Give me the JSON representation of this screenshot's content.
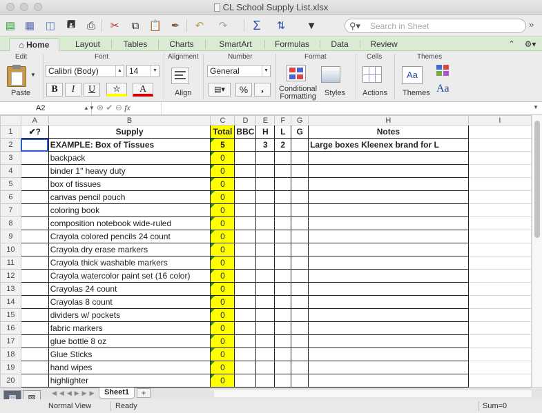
{
  "window": {
    "title": "CL School Supply List.xlsx"
  },
  "search": {
    "placeholder": "Search in Sheet"
  },
  "tabs": [
    "Home",
    "Layout",
    "Tables",
    "Charts",
    "SmartArt",
    "Formulas",
    "Data",
    "Review"
  ],
  "active_tab": "Home",
  "ribbon": {
    "groups": {
      "edit": "Edit",
      "font": "Font",
      "alignment": "Alignment",
      "number": "Number",
      "format": "Format",
      "cells": "Cells",
      "themes": "Themes"
    },
    "paste_label": "Paste",
    "font_name": "Calibri (Body)",
    "font_size": "14",
    "bold": "B",
    "italic": "I",
    "underline": "U",
    "align_label": "Align",
    "number_format": "General",
    "percent": "%",
    "comma": ",",
    "conditional_formatting_1": "Conditional",
    "conditional_formatting_2": "Formatting",
    "styles_label": "Styles",
    "actions_label": "Actions",
    "themes_label": "Themes",
    "themes_font": "Aa",
    "themes_sample": "Aa"
  },
  "formula_bar": {
    "cell_ref": "A2",
    "fx": "fx",
    "content": ""
  },
  "columns": [
    "A",
    "B",
    "C",
    "D",
    "E",
    "F",
    "G",
    "H",
    "I"
  ],
  "header_row": {
    "a": "✔?",
    "b": "Supply",
    "c": "Total",
    "d": "BBC",
    "e": "H",
    "f": "L",
    "g": "G",
    "h": "Notes"
  },
  "rows": [
    {
      "n": "2",
      "a": "",
      "b": "EXAMPLE:  Box of Tissues",
      "c": "5",
      "d": "",
      "e": "3",
      "f": "2",
      "g": "",
      "h": "Large boxes Kleenex brand for L"
    },
    {
      "n": "3",
      "b": "backpack",
      "c": "0"
    },
    {
      "n": "4",
      "b": "binder 1\" heavy duty",
      "c": "0"
    },
    {
      "n": "5",
      "b": "box of tissues",
      "c": "0"
    },
    {
      "n": "6",
      "b": "canvas pencil pouch",
      "c": "0"
    },
    {
      "n": "7",
      "b": "coloring book",
      "c": "0"
    },
    {
      "n": "8",
      "b": "composition notebook wide-ruled",
      "c": "0"
    },
    {
      "n": "9",
      "b": "Crayola colored pencils 24 count",
      "c": "0"
    },
    {
      "n": "10",
      "b": "Crayola dry erase markers",
      "c": "0"
    },
    {
      "n": "11",
      "b": "Crayola thick washable markers",
      "c": "0"
    },
    {
      "n": "12",
      "b": "Crayola watercolor paint set (16 color)",
      "c": "0"
    },
    {
      "n": "13",
      "b": "Crayolas 24 count",
      "c": "0"
    },
    {
      "n": "14",
      "b": "Crayolas 8 count",
      "c": "0"
    },
    {
      "n": "15",
      "b": "dividers w/ pockets",
      "c": "0"
    },
    {
      "n": "16",
      "b": "fabric markers",
      "c": "0"
    },
    {
      "n": "17",
      "b": "glue bottle 8 oz",
      "c": "0"
    },
    {
      "n": "18",
      "b": "Glue Sticks",
      "c": "0"
    },
    {
      "n": "19",
      "b": "hand wipes",
      "c": "0"
    },
    {
      "n": "20",
      "b": "highlighter",
      "c": "0"
    }
  ],
  "sheet_tab": "Sheet1",
  "add_sheet": "+",
  "status": {
    "view": "Normal View",
    "state": "Ready",
    "sum": "Sum=0"
  }
}
